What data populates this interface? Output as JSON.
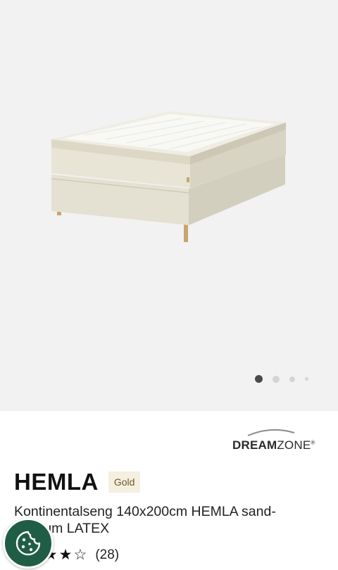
{
  "gallery": {
    "image_alt": "HEMLA boxspring bed",
    "dots_count": 4,
    "active_dot": 1
  },
  "brand": {
    "name_bold": "DREAM",
    "name_light": "ZONE",
    "mark": "®"
  },
  "product": {
    "title": "HEMLA",
    "badge": "Gold",
    "description": "Kontinentalseng 140x200cm HEMLA sand- Medium LATEX",
    "rating": {
      "stars": 3,
      "max": 5,
      "count_text": "(28)"
    }
  },
  "cookie_button": {
    "icon": "cookie-icon"
  },
  "colors": {
    "gallery_bg": "#f2f2f2",
    "badge_bg": "#f5efdf",
    "badge_text": "#6b5a2a",
    "cookie_bg": "#1f5e45"
  }
}
